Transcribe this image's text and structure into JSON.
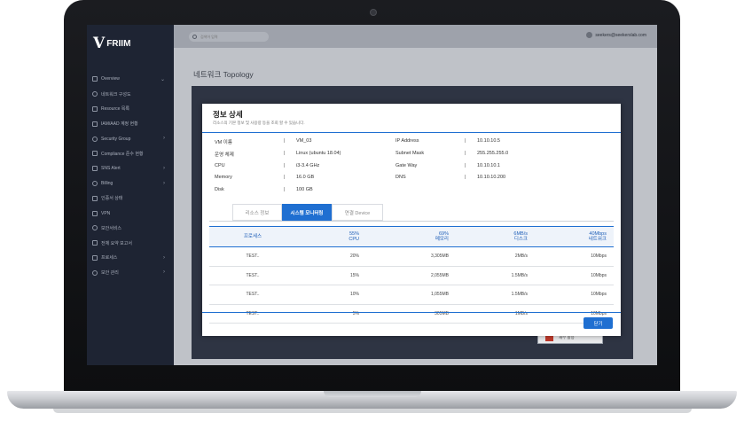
{
  "brand": {
    "logo_mark": "V",
    "name": "FRIIM"
  },
  "search": {
    "placeholder": "검색어 입력"
  },
  "user": {
    "email": "seekers@seekerslab.com"
  },
  "sidebar": {
    "items": [
      {
        "label": "Overview",
        "icon": "grid-icon",
        "chevron": "⌄"
      },
      {
        "label": "네트워크 구성도",
        "icon": "network-icon",
        "chevron": ""
      },
      {
        "label": "Resource 목록",
        "icon": "list-icon",
        "chevron": ""
      },
      {
        "label": "IAM/AAD 계정 현황",
        "icon": "user-icon",
        "chevron": ""
      },
      {
        "label": "Security Group",
        "icon": "shield-icon",
        "chevron": "›"
      },
      {
        "label": "Compliance 준수 현황",
        "icon": "check-icon",
        "chevron": ""
      },
      {
        "label": "SNS Alert",
        "icon": "alert-icon",
        "chevron": "›"
      },
      {
        "label": "Billing",
        "icon": "billing-icon",
        "chevron": "›"
      },
      {
        "label": "인증서 상태",
        "icon": "certificate-icon",
        "chevron": ""
      },
      {
        "label": "VPN",
        "icon": "vpn-icon",
        "chevron": ""
      },
      {
        "label": "보안서비스",
        "icon": "security-icon",
        "chevron": ""
      },
      {
        "label": "전체 요약 보고서",
        "icon": "report-icon",
        "chevron": ""
      },
      {
        "label": "프로세스",
        "icon": "process-icon",
        "chevron": "›"
      },
      {
        "label": "보안 관리",
        "icon": "settings-icon",
        "chevron": "›"
      }
    ]
  },
  "main": {
    "page_title": "네트워크 Topology",
    "under_button": "재부 활용"
  },
  "modal": {
    "title": "정보 상세",
    "subtitle": "리소스의 기본 정보 및 사용량 등을 조회 할 수 있습니다.",
    "info_left": [
      {
        "key": "VM 이름",
        "value": "VM_03"
      },
      {
        "key": "운영 체제",
        "value": "Linux (ubuntu 18.04)"
      },
      {
        "key": "CPU",
        "value": "i3-3.4 GHz"
      },
      {
        "key": "Memory",
        "value": "16.0 GB"
      },
      {
        "key": "Disk",
        "value": "100 GB"
      }
    ],
    "info_right": [
      {
        "key": "IP Address",
        "value": "10.10.10.5"
      },
      {
        "key": "Subnet Mask",
        "value": "255.255.255.0"
      },
      {
        "key": "Gate Way",
        "value": "10.10.10.1"
      },
      {
        "key": "DNS",
        "value": "10.10.10.200"
      }
    ],
    "separator": "|",
    "tabs": [
      {
        "label": "리소스 정보",
        "active": false
      },
      {
        "label": "시스템 모니터링",
        "active": true
      },
      {
        "label": "연결 Device",
        "active": false
      }
    ],
    "table": {
      "headers": [
        {
          "top": "프로세스",
          "bottom": ""
        },
        {
          "top": "55%",
          "bottom": "CPU"
        },
        {
          "top": "69%",
          "bottom": "메모리"
        },
        {
          "top": "6MB/s",
          "bottom": "디스크"
        },
        {
          "top": "40Mbps",
          "bottom": "네트워크"
        }
      ],
      "rows": [
        [
          "TEST..",
          "20%",
          "3,305MB",
          "2MB/s",
          "10Mbps"
        ],
        [
          "TEST..",
          "15%",
          "2,055MB",
          "1.5MB/s",
          "10Mbps"
        ],
        [
          "TEST..",
          "10%",
          "1,055MB",
          "1.5MB/s",
          "10Mbps"
        ],
        [
          "TEST..",
          "5%",
          "305MB",
          "1MB/s",
          "10Mbps"
        ]
      ]
    },
    "close_label": "닫기"
  },
  "colors": {
    "accent": "#1f6fd1",
    "sidebar": "#1e2433",
    "panel": "#2e3443"
  }
}
